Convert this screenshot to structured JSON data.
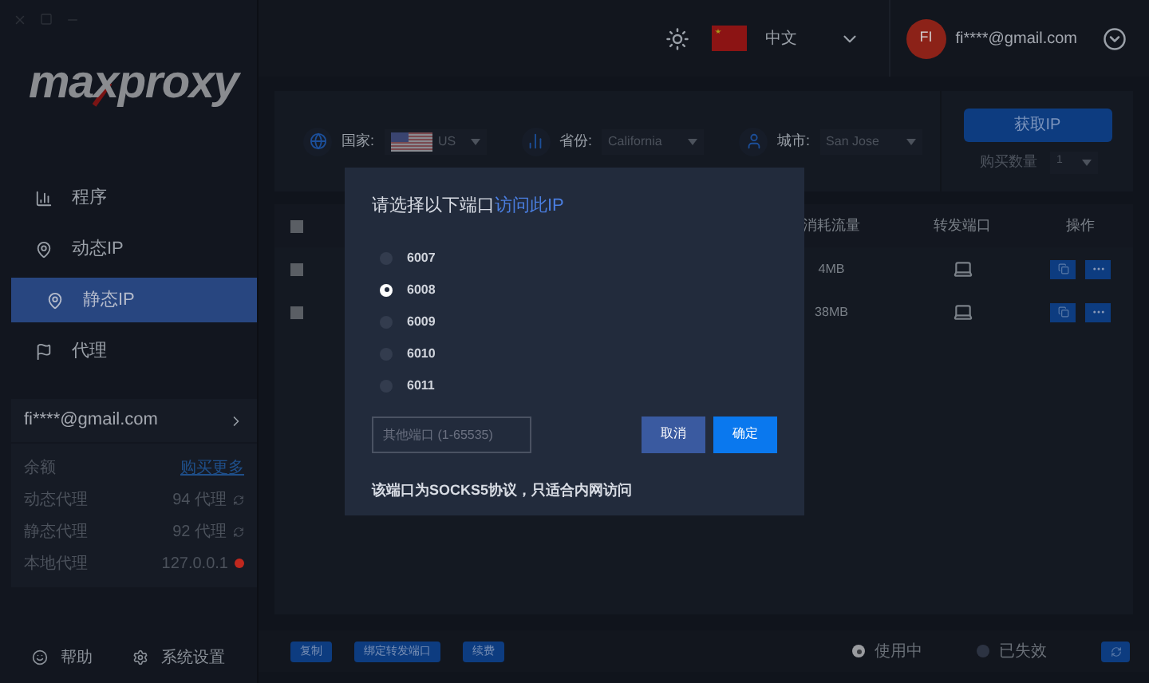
{
  "logo": {
    "text": "maxproxy"
  },
  "header": {
    "language": "中文",
    "avatar_initials": "FI",
    "email": "fi****@gmail.com"
  },
  "sidebar": {
    "nav": [
      {
        "label": "程序",
        "selected": false
      },
      {
        "label": "动态IP",
        "selected": false
      },
      {
        "label": "静态IP",
        "selected": true
      },
      {
        "label": "代理",
        "selected": false
      }
    ],
    "account": {
      "email": "fi****@gmail.com",
      "rows": [
        {
          "kind": "link",
          "label": "余额",
          "value": "购买更多"
        },
        {
          "kind": "refresh",
          "label": "动态代理",
          "value": "94 代理"
        },
        {
          "kind": "refresh",
          "label": "静态代理",
          "value": "92 代理"
        },
        {
          "kind": "status",
          "label": "本地代理",
          "value": "127.0.0.1",
          "color": "#c0281e"
        }
      ]
    },
    "footer": [
      {
        "label": "帮助"
      },
      {
        "label": "系统设置"
      }
    ]
  },
  "filters": [
    {
      "label": "国家:",
      "value": "US"
    },
    {
      "label": "省份:",
      "value": "California"
    },
    {
      "label": "城市:",
      "value": "San Jose"
    }
  ],
  "get_ip_button": "获取IP",
  "quantity": {
    "label": "购买数量",
    "value": "1"
  },
  "table": {
    "header_checked": false,
    "columns": [
      "消耗流量",
      "转发端口",
      "操作"
    ],
    "rows": [
      {
        "checked": false,
        "traffic": "4MB"
      },
      {
        "checked": false,
        "traffic": "38MB"
      }
    ]
  },
  "bottom_bar": {
    "buttons": [
      "复制",
      "绑定转发端口",
      "续费"
    ],
    "legend": [
      {
        "label": "使用中",
        "selected": true
      },
      {
        "label": "已失效",
        "selected": false
      }
    ]
  },
  "dialog": {
    "title": "请选择以下端口",
    "title_link": "访问此IP",
    "ports": [
      {
        "label": "6007",
        "selected": false
      },
      {
        "label": "6008",
        "selected": true
      },
      {
        "label": "6009",
        "selected": false
      },
      {
        "label": "6010",
        "selected": false
      },
      {
        "label": "6011",
        "selected": false
      }
    ],
    "custom_port": {
      "placeholder": "其他端口 (1-65535)"
    },
    "buttons": [
      {
        "kind": "secondary",
        "label": "取消"
      },
      {
        "kind": "primary",
        "label": "确定"
      }
    ],
    "note": "该端口为SOCKS5协议，只适合内网访问"
  }
}
